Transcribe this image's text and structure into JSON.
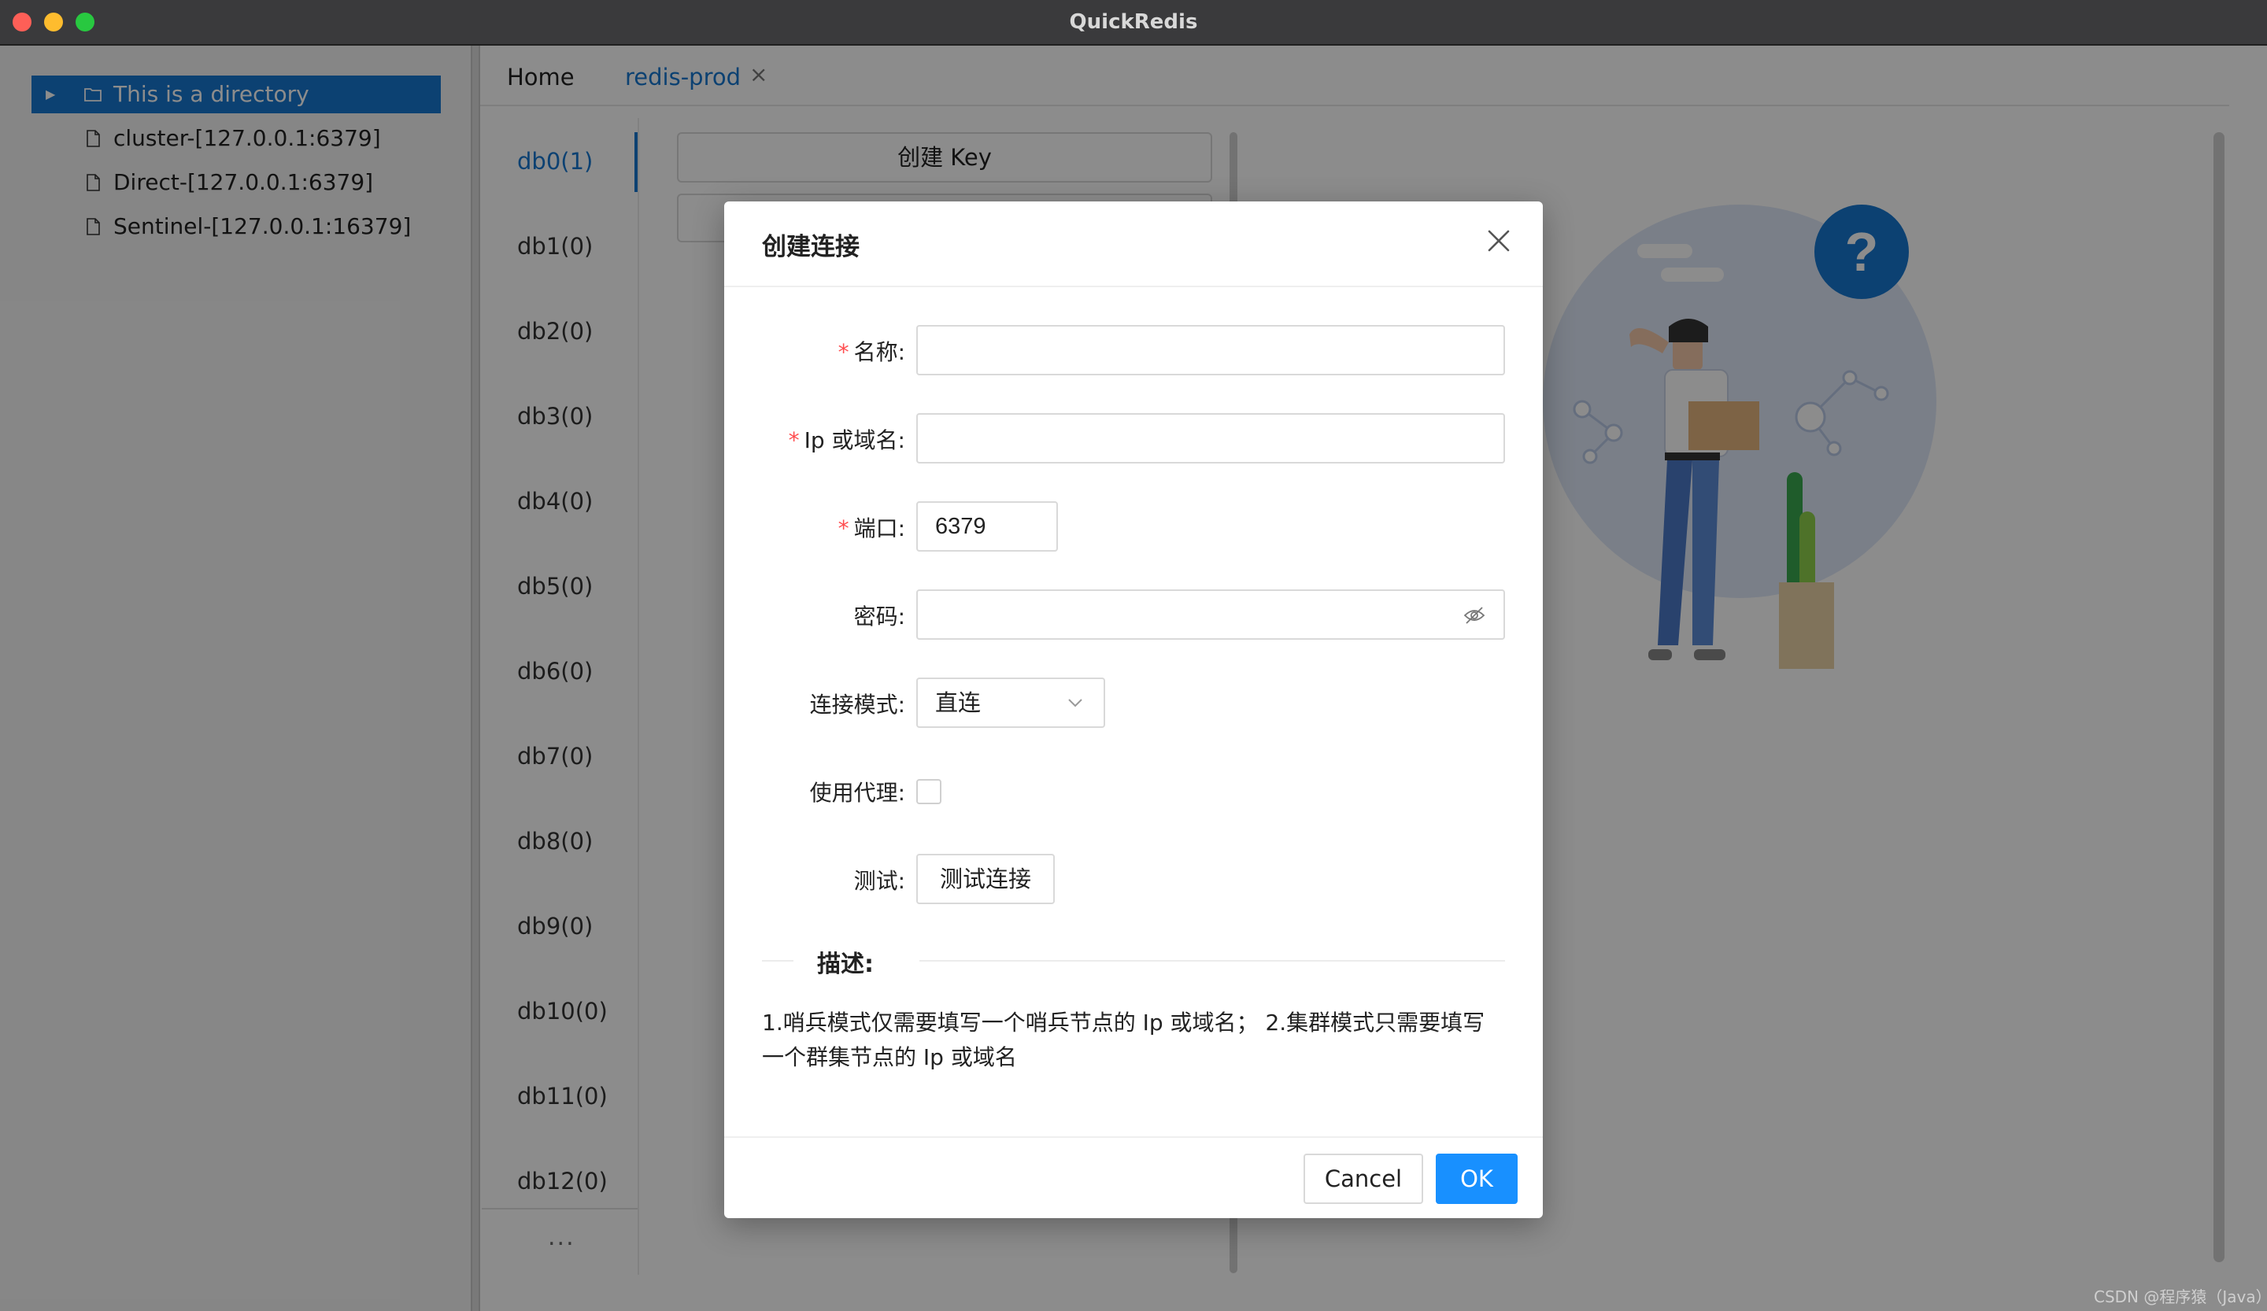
{
  "window": {
    "title": "QuickRedis"
  },
  "sidebar": {
    "items": [
      {
        "label": "This is a directory",
        "type": "directory",
        "selected": true
      },
      {
        "label": "cluster-[127.0.0.1:6379]",
        "type": "file"
      },
      {
        "label": "Direct-[127.0.0.1:6379]",
        "type": "file"
      },
      {
        "label": "Sentinel-[127.0.0.1:16379]",
        "type": "file"
      }
    ]
  },
  "tabs": [
    {
      "label": "Home"
    },
    {
      "label": "redis-prod",
      "active": true,
      "close_icon": "close-icon",
      "close_glyph": "×"
    }
  ],
  "databases": [
    "db0(1)",
    "db1(0)",
    "db2(0)",
    "db3(0)",
    "db4(0)",
    "db5(0)",
    "db6(0)",
    "db7(0)",
    "db8(0)",
    "db9(0)",
    "db10(0)",
    "db11(0)",
    "db12(0)"
  ],
  "databases_more": "...",
  "key_panel": {
    "create_key_label": "创建 Key"
  },
  "help_glyph": "?",
  "dialog": {
    "title": "创建连接",
    "required_mark": "*",
    "fields": {
      "name_label": "名称:",
      "name_value": "",
      "host_label": "Ip 或域名:",
      "host_value": "",
      "port_label": "端口:",
      "port_value": "6379",
      "password_label": "密码:",
      "password_value": "",
      "mode_label": "连接模式:",
      "mode_value": "直连",
      "proxy_label": "使用代理:",
      "proxy_checked": false,
      "test_label": "测试:",
      "test_button": "测试连接"
    },
    "description_title": "描述:",
    "description_text": "1.哨兵模式仅需要填写一个哨兵节点的 Ip 或域名； 2.集群模式只需要填写一个群集节点的 Ip 或域名",
    "cancel_label": "Cancel",
    "ok_label": "OK"
  },
  "colors": {
    "accent": "#1677cf",
    "primary_button": "#1890ff",
    "required": "#ff4d4f"
  },
  "watermark": "CSDN @程序猿（Java）"
}
